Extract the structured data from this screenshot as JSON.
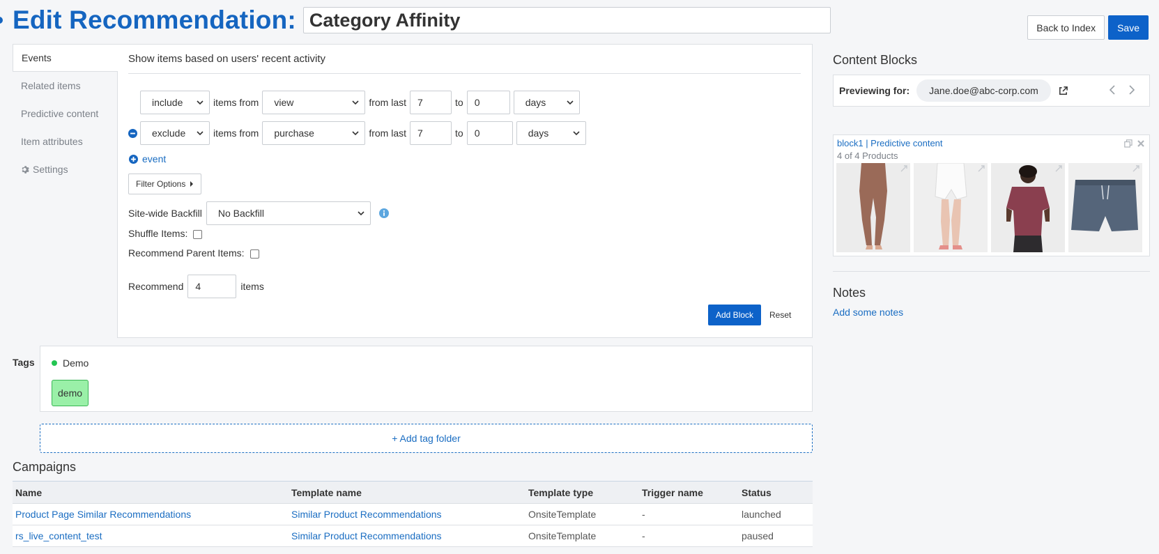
{
  "header": {
    "title": "Edit Recommendation:",
    "name_value": "Category Affinity",
    "back_label": "Back to Index",
    "save_label": "Save"
  },
  "side_tabs": [
    {
      "label": "Events",
      "active": true
    },
    {
      "label": "Related items",
      "active": false
    },
    {
      "label": "Predictive content",
      "active": false
    },
    {
      "label": "Item attributes",
      "active": false
    },
    {
      "label": "Settings",
      "active": false,
      "icon": "gear-icon"
    }
  ],
  "events": {
    "heading": "Show items based on users' recent activity",
    "rules": [
      {
        "mode": "include",
        "items_from_label": "items from",
        "event": "view",
        "from_last_label": "from last",
        "from": "7",
        "to_label": "to",
        "to": "0",
        "unit": "days"
      },
      {
        "mode": "exclude",
        "items_from_label": "items from",
        "event": "purchase",
        "from_last_label": "from last",
        "from": "7",
        "to_label": "to",
        "to": "0",
        "unit": "days"
      }
    ],
    "add_event_label": "event",
    "filter_options_label": "Filter Options",
    "backfill_label": "Site-wide Backfill",
    "backfill_value": "No Backfill",
    "shuffle_label": "Shuffle Items:",
    "parent_label": "Recommend Parent Items:",
    "recommend_label": "Recommend",
    "recommend_count": "4",
    "items_label": "items",
    "add_block_label": "Add Block",
    "reset_label": "Reset"
  },
  "content_blocks": {
    "heading": "Content Blocks",
    "previewing_label": "Previewing for:",
    "preview_user": "Jane.doe@abc-corp.com",
    "block": {
      "title": "block1 | Predictive content",
      "subtitle": "4 of 4 Products",
      "products": [
        {
          "kind": "leggings",
          "color": "#9a6a58"
        },
        {
          "kind": "shorts",
          "color": "#f3f3f3"
        },
        {
          "kind": "polo",
          "color": "#8a3f4f"
        },
        {
          "kind": "swim-shorts",
          "color": "#55657a"
        }
      ]
    }
  },
  "notes": {
    "heading": "Notes",
    "add_label": "Add some notes"
  },
  "tags": {
    "label": "Tags",
    "folder_name": "Demo",
    "chip": "demo",
    "add_folder_label": "+ Add tag folder"
  },
  "campaigns": {
    "heading": "Campaigns",
    "columns": [
      "Name",
      "Template name",
      "Template type",
      "Trigger name",
      "Status"
    ],
    "rows": [
      [
        "Product Page Similar Recommendations",
        "Similar Product Recommendations",
        "OnsiteTemplate",
        "-",
        "launched"
      ],
      [
        "rs_live_content_test",
        "Similar Product Recommendations",
        "OnsiteTemplate",
        "-",
        "paused"
      ]
    ]
  },
  "colors": {
    "brand": "#1565c0",
    "primary_button": "#0d62c9",
    "link": "#1a6dc2",
    "tag_green": "#9af0a8",
    "status_dot": "#23c552"
  }
}
